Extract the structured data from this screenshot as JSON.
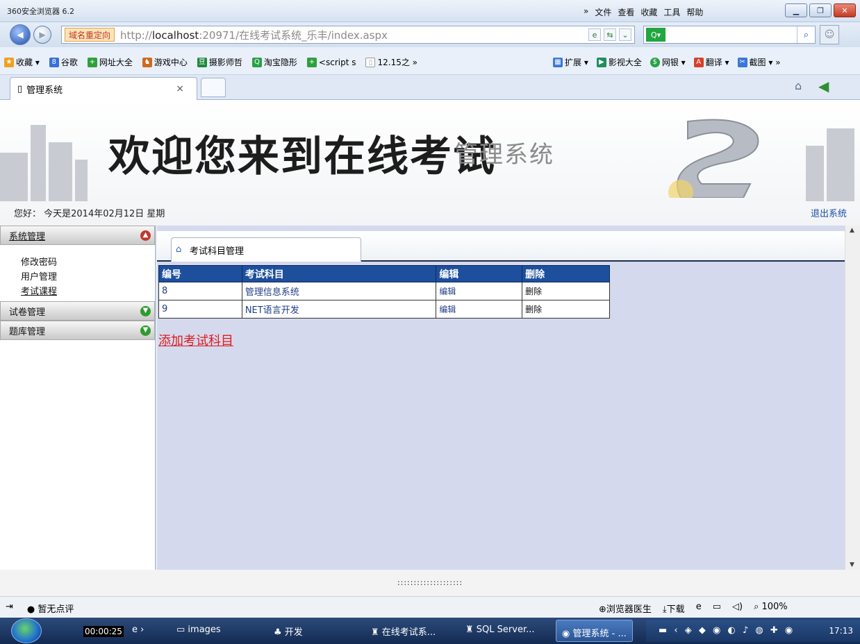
{
  "window": {
    "app_title": "360安全浏览器 6.2",
    "menu": [
      "»",
      "文件",
      "查看",
      "收藏",
      "工具",
      "帮助"
    ]
  },
  "address_bar": {
    "redirect_label": "域名重定向",
    "url_prefix": "http://",
    "url_host": "localhost",
    "url_rest": ":20971/在线考试系统_乐丰/index.aspx"
  },
  "favorites": {
    "left": [
      "收藏 ▾",
      "谷歌",
      "网址大全",
      "游戏中心",
      "摄影师哲",
      "淘宝隐形",
      "<script s",
      "12.15之 »"
    ],
    "right": [
      "扩展 ▾",
      "影视大全",
      "网银 ▾",
      "翻译 ▾",
      "截图 ▾ »"
    ]
  },
  "browser_tab": {
    "label": "管理系统",
    "close": "×"
  },
  "banner": {
    "title": "欢迎您来到在线考试",
    "subtitle": "管理系统",
    "greeting": "您好：  今天是2014年02月12日  星期",
    "logout": "退出系统"
  },
  "sidebar": {
    "sections": [
      {
        "title": "系统管理",
        "expanded": true,
        "items": [
          "修改密码",
          "用户管理",
          "考试课程"
        ]
      },
      {
        "title": "试卷管理",
        "expanded": false,
        "items": []
      },
      {
        "title": "题库管理",
        "expanded": false,
        "items": []
      }
    ]
  },
  "content": {
    "tab_label": "考试科目管理",
    "columns": [
      "编号",
      "考试科目",
      "编辑",
      "删除"
    ],
    "rows": [
      {
        "id": "8",
        "subject": "管理信息系统",
        "edit": "编辑",
        "del": "删除"
      },
      {
        "id": "9",
        "subject": "NET语言开发",
        "edit": "编辑",
        "del": "删除"
      }
    ],
    "add_link": "添加考试科目"
  },
  "footer": {
    "dots": "::::::::::::::::::::"
  },
  "status_bar": {
    "left": "暂无点评",
    "right": [
      "浏览器医生",
      "下载",
      "100%"
    ]
  },
  "taskbar": {
    "timer": "00:00:25",
    "tasks": [
      "images",
      "开发",
      "在线考试系...",
      "SQL Server...",
      "管理系统 - ..."
    ],
    "clock": "17:13"
  },
  "colors": {
    "table_header": "#1d4f9c",
    "content_bg": "#d4d9ee",
    "add_link": "#e01b1b",
    "logout_link": "#1a4fa8"
  }
}
